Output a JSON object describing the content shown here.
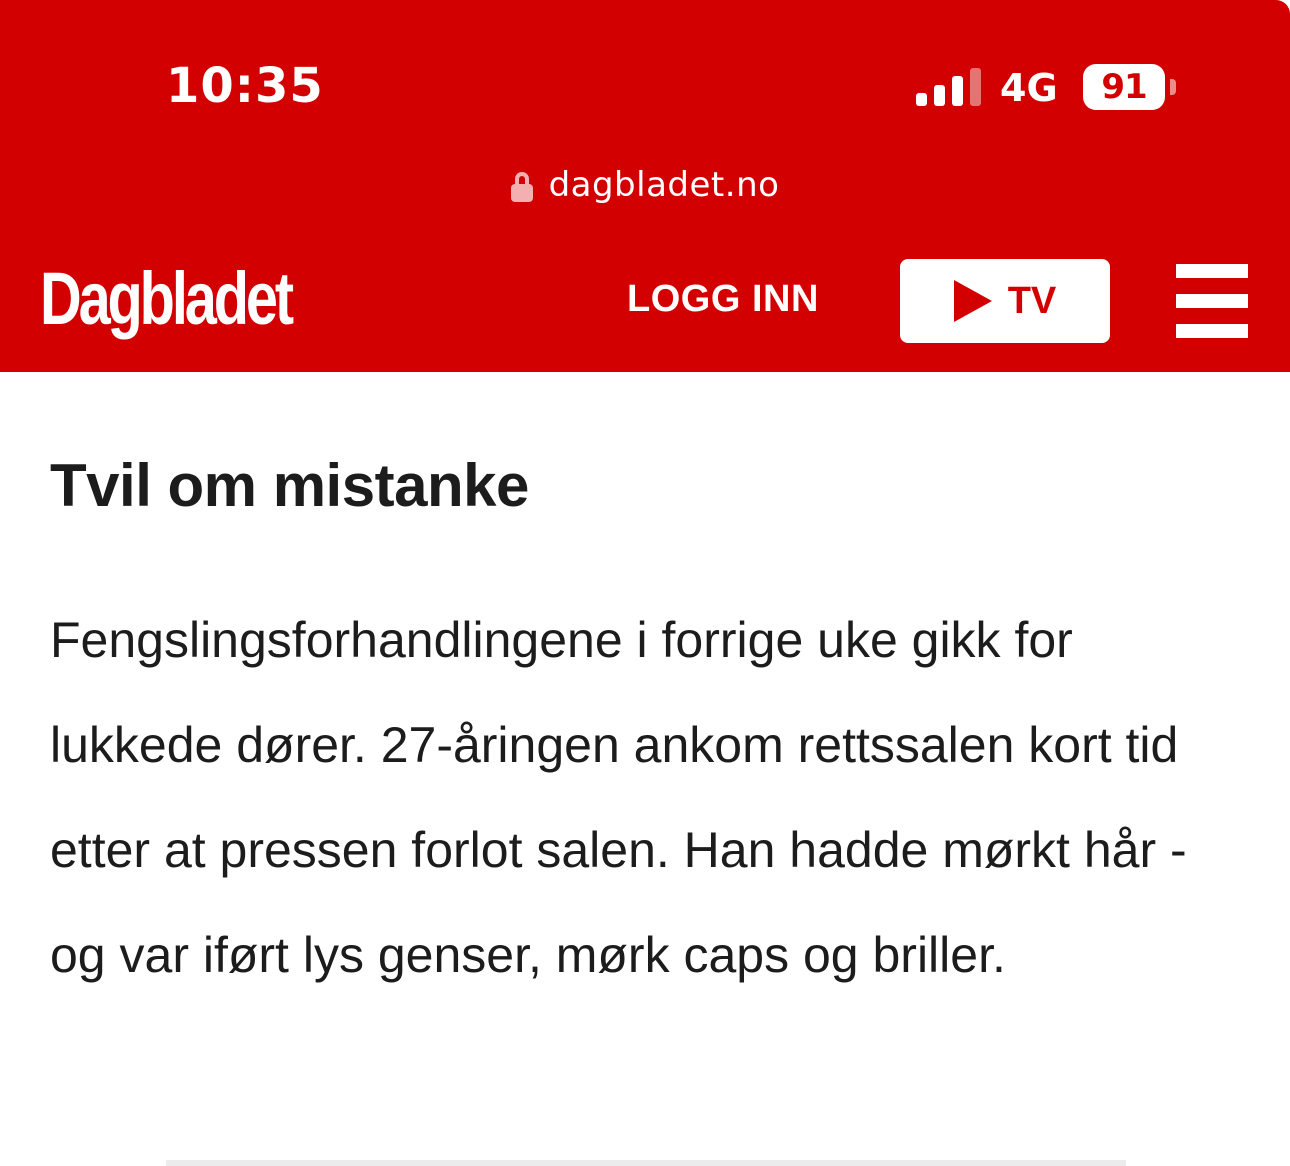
{
  "status_bar": {
    "time": "10:35",
    "network": "4G",
    "battery": "91",
    "signal_bars_filled": 3,
    "signal_bars_total": 4
  },
  "browser": {
    "url": "dagbladet.no"
  },
  "header": {
    "logo": "Dagbladet",
    "login": "LOGG INN",
    "tv_label": "TV"
  },
  "article": {
    "heading": "Tvil om mistanke",
    "body": "Fengslingsforhandlingene i forrige uke gikk for lukkede dører. 27-åringen ankom rettssalen kort tid etter at pressen forlot salen. Han hadde mørkt hår - og var iført lys genser, mørk caps og briller."
  },
  "colors": {
    "brand_red": "#d20000",
    "text": "#1c1c1c",
    "background": "#ffffff"
  },
  "icons": [
    "lock-icon",
    "play-icon",
    "hamburger-menu-icon",
    "signal-icon",
    "battery-icon"
  ]
}
